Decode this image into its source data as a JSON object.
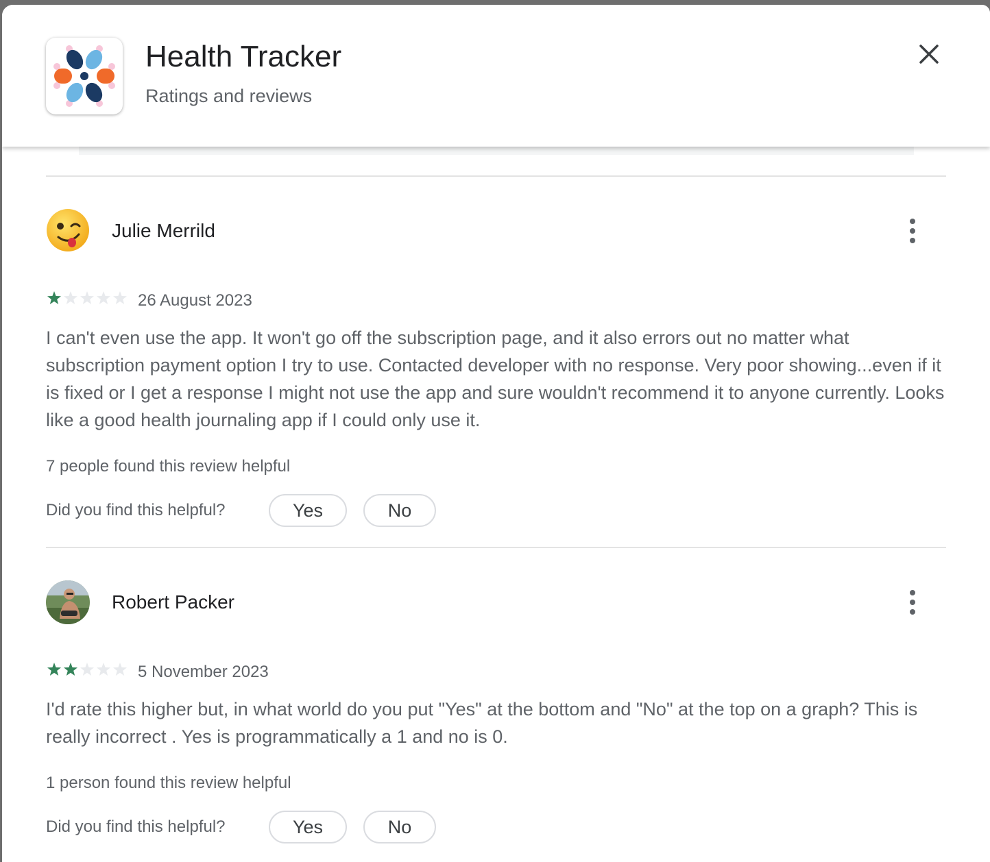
{
  "header": {
    "app_name": "Health Tracker",
    "subtitle": "Ratings and reviews",
    "icon": "health-tracker-flower-logo",
    "close_icon": "close-icon"
  },
  "colors": {
    "star_filled": "#34845a",
    "star_empty": "#e8eaed",
    "text_primary": "#202124",
    "text_secondary": "#5f6368",
    "button_border": "#dadce0",
    "logo_dark_blue": "#1b3a63",
    "logo_light_blue": "#6cb5e3",
    "logo_orange": "#f06a2a",
    "logo_pink": "#f7c6d9"
  },
  "reviews": [
    {
      "reviewer": "Julie Merrild",
      "avatar": "winking-emoji-avatar",
      "rating": 1,
      "max_rating": 5,
      "date": "26 August 2023",
      "text": "I can't even use the app. It won't go off the subscription page, and it also errors out no matter what subscription payment option I try to use. Contacted developer with no response. Very poor showing...even if it is fixed or I get a response I might not use the app and sure wouldn't recommend it to anyone currently. Looks like a good health journaling app if I could only use it.",
      "helpful_count_text": "7 people found this review helpful",
      "helpful_question": "Did you find this helpful?",
      "yes_label": "Yes",
      "no_label": "No"
    },
    {
      "reviewer": "Robert Packer",
      "avatar": "photo-avatar",
      "rating": 2,
      "max_rating": 5,
      "date": "5 November 2023",
      "text": "I'd rate this higher but, in what world do you put \"Yes\" at the bottom and \"No\" at the top on a graph? This is really incorrect . Yes is programmatically a 1 and no is 0.",
      "helpful_count_text": "1 person found this review helpful",
      "helpful_question": "Did you find this helpful?",
      "yes_label": "Yes",
      "no_label": "No"
    }
  ]
}
